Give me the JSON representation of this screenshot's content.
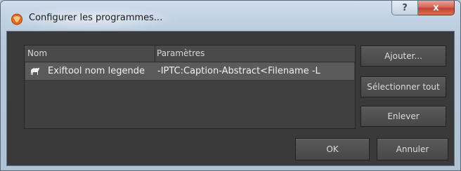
{
  "window": {
    "title": "Configurer les programmes...",
    "help_glyph": "?",
    "close_glyph": "x"
  },
  "list": {
    "columns": [
      "Nom",
      "Paramètres"
    ],
    "rows": [
      {
        "name": "Exiftool nom legende",
        "params": "-IPTC:Caption-Abstract<Filename -L",
        "icon": "camel-icon"
      }
    ]
  },
  "buttons": {
    "add": "Ajouter...",
    "select_all": "Sélectionner tout",
    "remove": "Enlever",
    "ok": "OK",
    "cancel": "Annuler"
  },
  "colors": {
    "app_icon": "#e36b1d",
    "close_button": "#c8453a"
  }
}
